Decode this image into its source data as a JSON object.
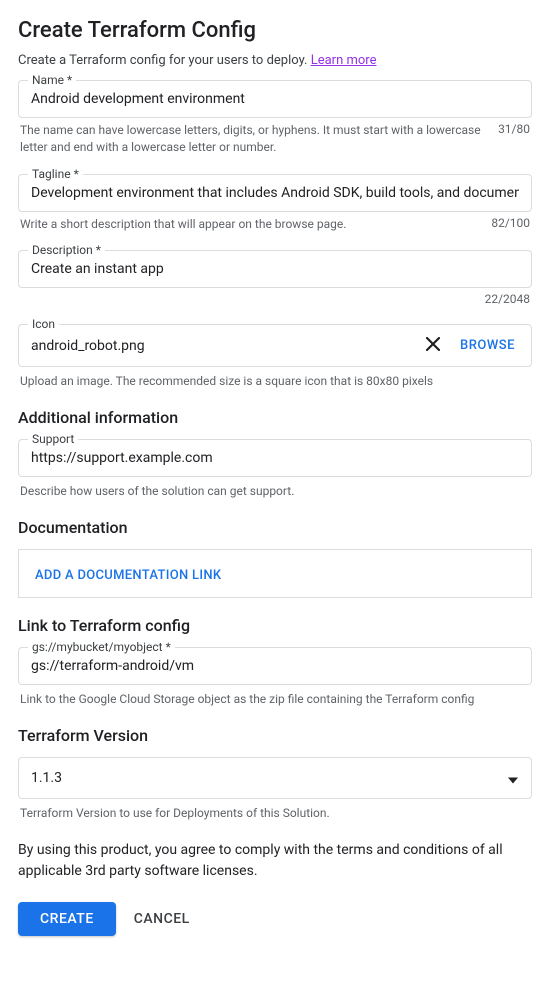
{
  "page": {
    "title": "Create Terraform Config",
    "subtitle": "Create a Terraform config for your users to deploy. ",
    "learnMore": "Learn more"
  },
  "name": {
    "label": "Name *",
    "value": "Android development environment",
    "helper": "The name can have lowercase letters, digits, or hyphens. It must start with a lowercase letter and end with a lowercase letter or number.",
    "counter": "31/80"
  },
  "tagline": {
    "label": "Tagline *",
    "value": "Development environment that includes Android SDK, build tools, and documentation.",
    "helper": "Write a short description that will appear on the browse page.",
    "counter": "82/100"
  },
  "description": {
    "label": "Description *",
    "value": "Create an instant app",
    "counter": "22/2048"
  },
  "icon": {
    "label": "Icon",
    "value": "android_robot.png",
    "browse": "BROWSE",
    "helper": "Upload an image. The recommended size is a square icon that is 80x80 pixels"
  },
  "additionalInfo": {
    "heading": "Additional information"
  },
  "support": {
    "label": "Support",
    "value": "https://support.example.com",
    "helper": "Describe how users of the solution can get support."
  },
  "documentation": {
    "heading": "Documentation",
    "addLink": "ADD A DOCUMENTATION LINK"
  },
  "linkConfig": {
    "heading": "Link to Terraform config",
    "label": "gs://mybucket/myobject *",
    "value": "gs://terraform-android/vm",
    "helper": "Link to the Google Cloud Storage object as the zip file containing the Terraform config"
  },
  "version": {
    "heading": "Terraform Version",
    "value": "1.1.3",
    "helper": "Terraform Version to use for Deployments of this Solution."
  },
  "terms": "By using this product, you agree to comply with the terms and conditions of all applicable 3rd party software licenses.",
  "buttons": {
    "create": "CREATE",
    "cancel": "CANCEL"
  }
}
